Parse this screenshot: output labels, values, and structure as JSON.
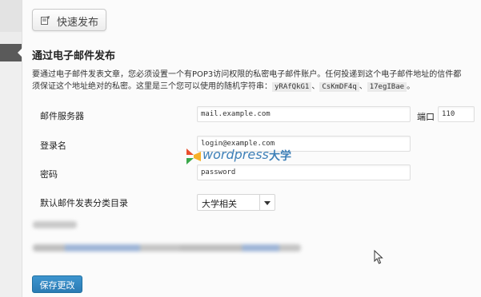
{
  "press": {
    "label": "快速发布",
    "icon": "press-this-icon"
  },
  "section": {
    "title": "通过电子邮件发布",
    "desc_line1": "要通过电子邮件发表文章，您必须设置一个有POP3访问权限的私密电子邮件账户。任何投递到这个电子邮件地址的信件都",
    "desc_line2_prefix": "须保证这个地址绝对的私密。这里是三个您可以使用的随机字符串：",
    "codes": [
      "yRAfQkG1",
      "CsKmDF4q",
      "17egIBae"
    ],
    "sep": "、",
    "end": "。"
  },
  "fields": {
    "server_label": "邮件服务器",
    "server_value": "mail.example.com",
    "port_label": "端口",
    "port_value": "110",
    "login_label": "登录名",
    "login_value": "login@example.com",
    "password_label": "密码",
    "password_value": "password",
    "category_label": "默认邮件发表分类目录",
    "category_value": "大学相关"
  },
  "watermark": {
    "text": "wordpress",
    "cn": "大学"
  },
  "save_label": "保存更改",
  "colors": {
    "primary": "#2b7bb4",
    "watermark": "#3d7fb7",
    "admin_active": "#5a5a5a"
  }
}
